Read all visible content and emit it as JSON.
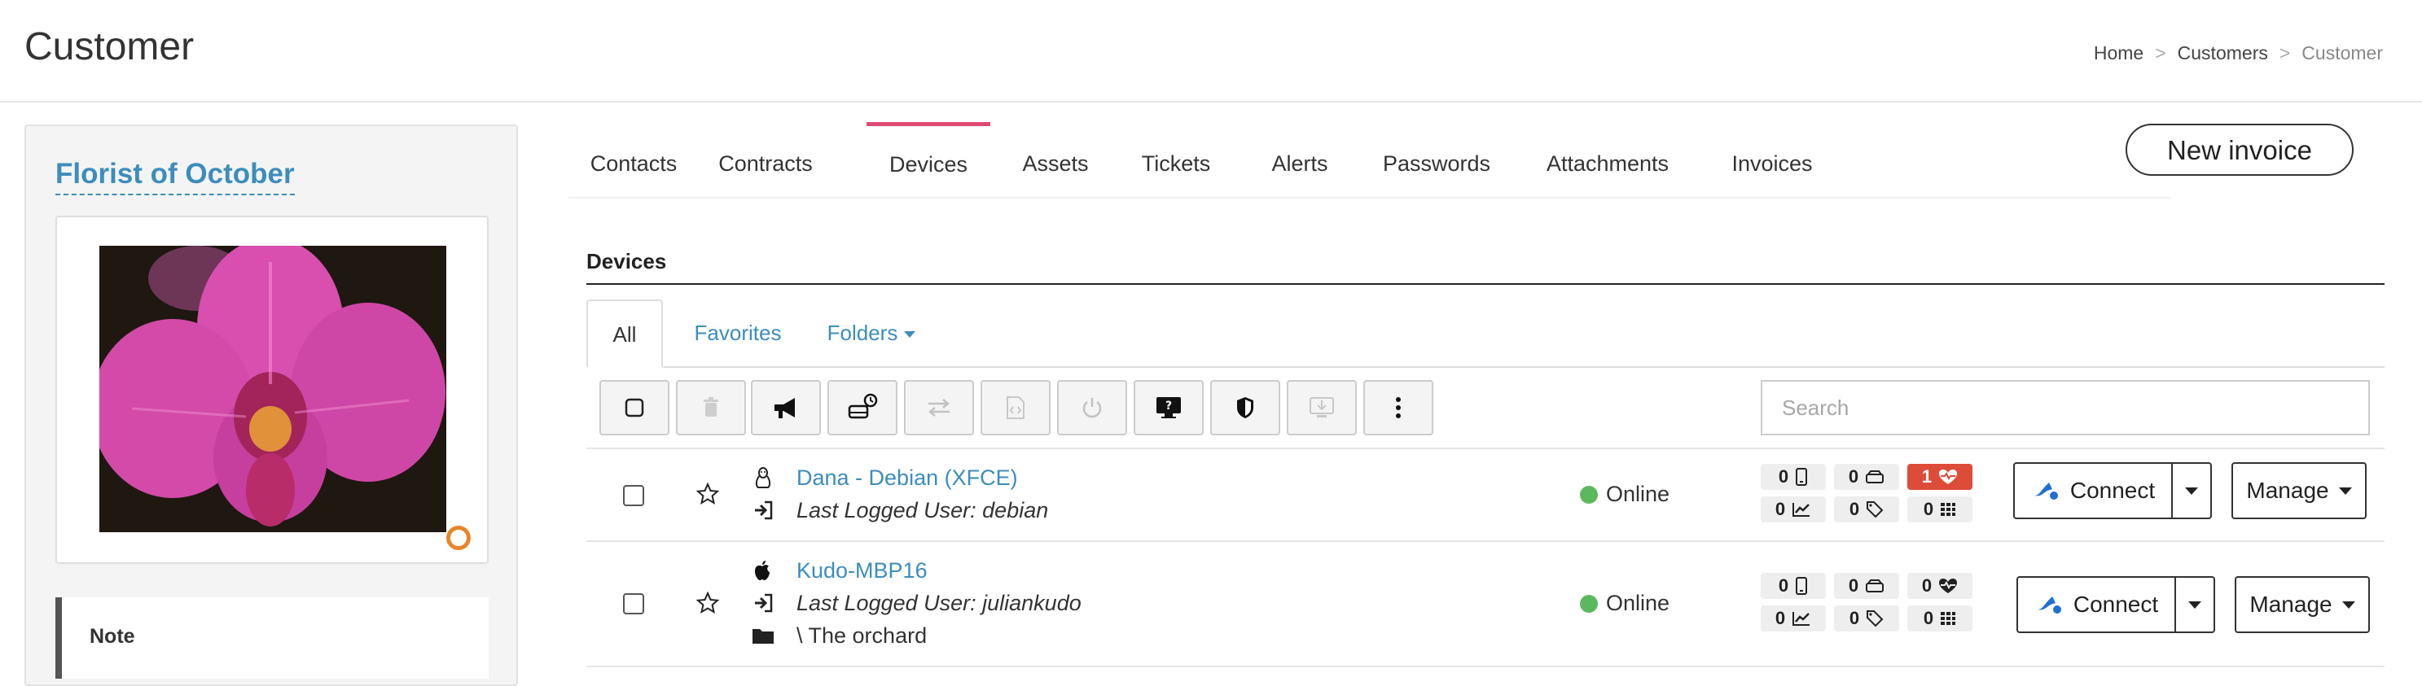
{
  "page": {
    "title": "Customer"
  },
  "breadcrumb": {
    "home": "Home",
    "customers": "Customers",
    "current": "Customer",
    "separator": ">"
  },
  "customer": {
    "name": "Florist of October",
    "note_title": "Note"
  },
  "tabs": [
    {
      "label": "Contacts"
    },
    {
      "label": "Contracts"
    },
    {
      "label": "Devices",
      "active": true
    },
    {
      "label": "Assets"
    },
    {
      "label": "Tickets"
    },
    {
      "label": "Alerts"
    },
    {
      "label": "Passwords"
    },
    {
      "label": "Attachments"
    },
    {
      "label": "Invoices"
    }
  ],
  "actions": {
    "new_invoice": "New invoice"
  },
  "devices": {
    "section_title": "Devices",
    "subtabs": {
      "all": "All",
      "favorites": "Favorites",
      "folders": "Folders"
    },
    "search": {
      "placeholder": "Search"
    },
    "rows": [
      {
        "os_icon": "linux-icon",
        "name": "Dana - Debian (XFCE)",
        "last_user": "Last Logged User: debian",
        "folder": "",
        "status": "Online",
        "counters": {
          "mobile": "0",
          "storage": "0",
          "health": "1",
          "perf": "0",
          "tags": "0",
          "apps": "0"
        },
        "connect_label": "Connect",
        "manage_label": "Manage"
      },
      {
        "os_icon": "apple-icon",
        "name": "Kudo-MBP16",
        "last_user": "Last Logged User: juliankudo",
        "folder": "\\ The orchard",
        "status": "Online",
        "counters": {
          "mobile": "0",
          "storage": "0",
          "health": "0",
          "perf": "0",
          "tags": "0",
          "apps": "0"
        },
        "connect_label": "Connect",
        "manage_label": "Manage"
      }
    ]
  },
  "colors": {
    "link": "#3c8dbc",
    "active_tab": "#dd4b73",
    "online": "#5cb85c",
    "alert_badge": "#dd4b39"
  }
}
